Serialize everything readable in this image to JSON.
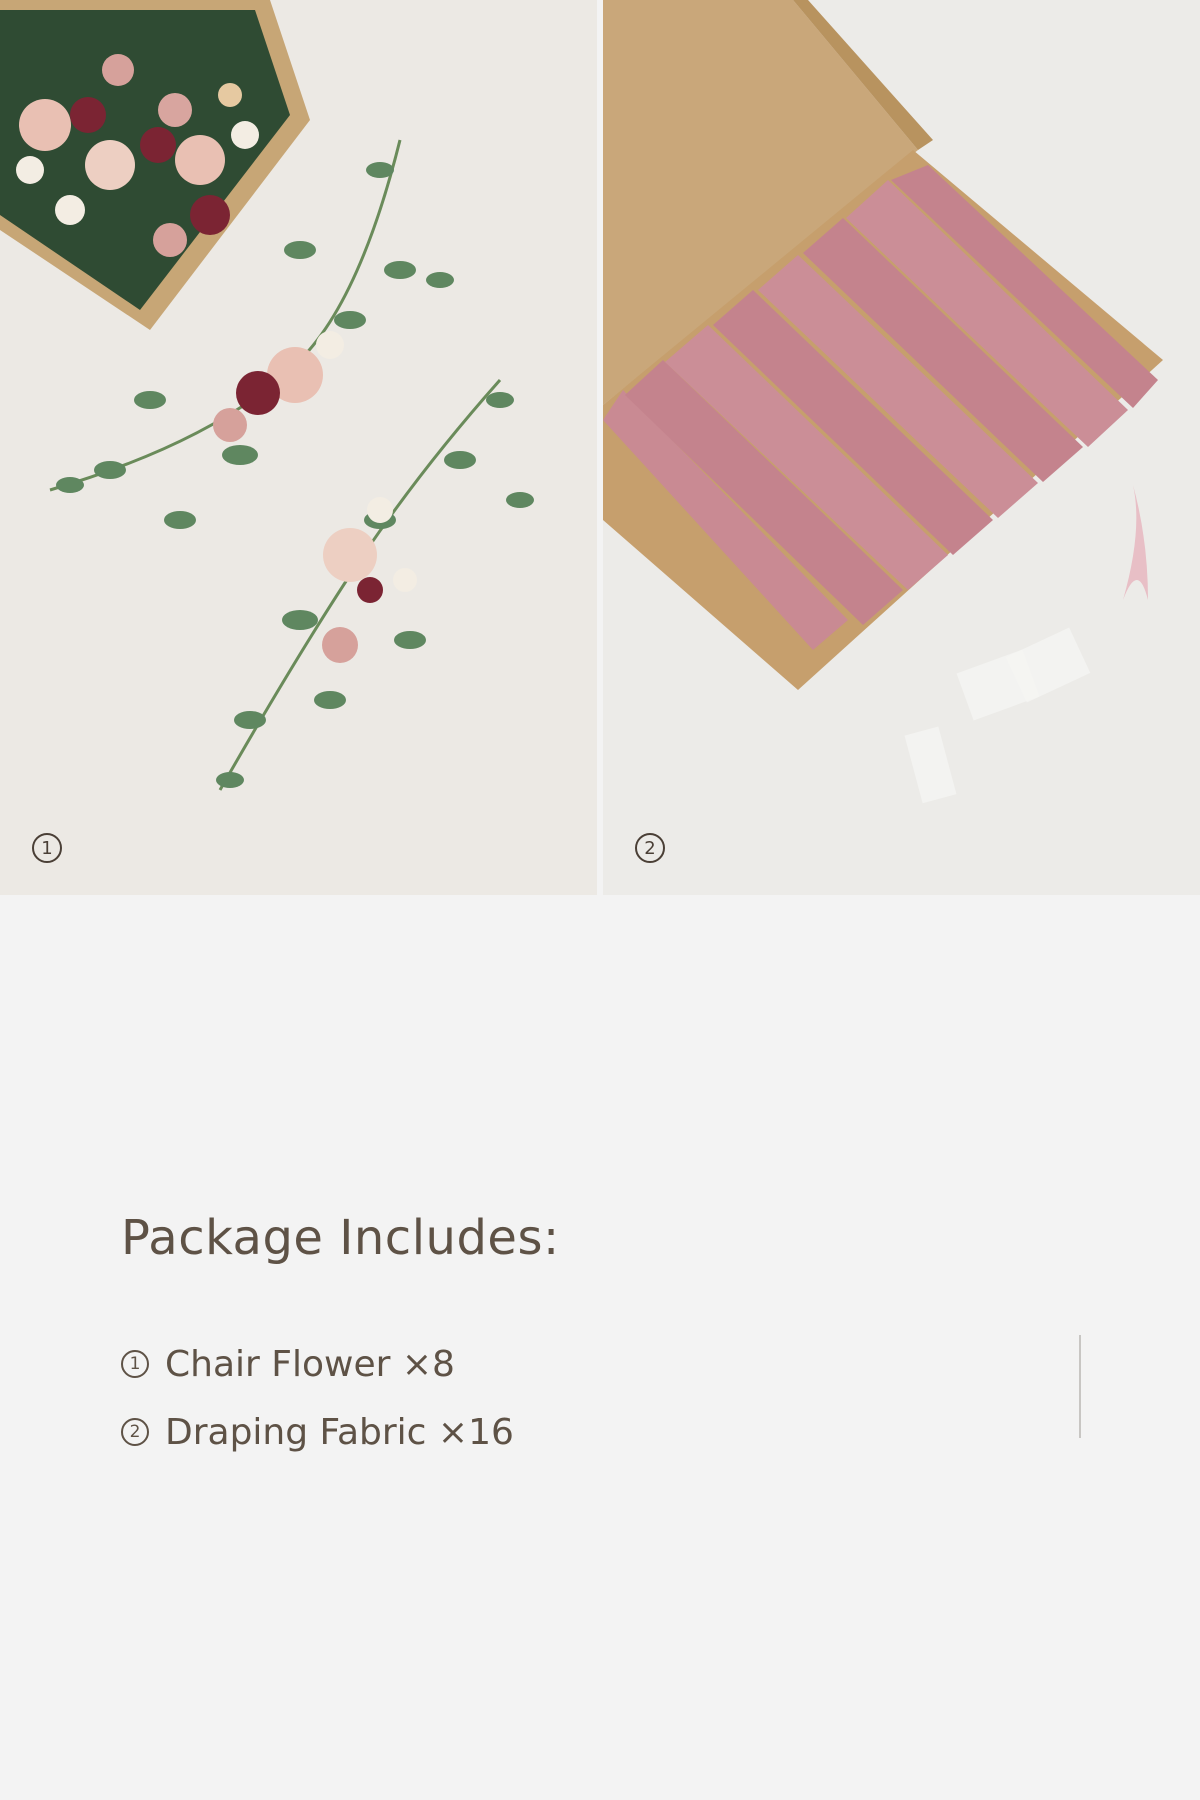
{
  "images": [
    {
      "number": "1",
      "subject": "chair-flower-box-photo"
    },
    {
      "number": "2",
      "subject": "draping-fabric-box-photo"
    }
  ],
  "package": {
    "title": "Package Includes:",
    "items": [
      {
        "number": "1",
        "label": "Chair Flower ×8"
      },
      {
        "number": "2",
        "label": "Draping Fabric ×16"
      }
    ]
  },
  "colors": {
    "text": "#5e5246",
    "background": "#f3f3f3",
    "fabric": "#c98a93",
    "leaf": "#5f8760",
    "box": "#c9a77a"
  }
}
